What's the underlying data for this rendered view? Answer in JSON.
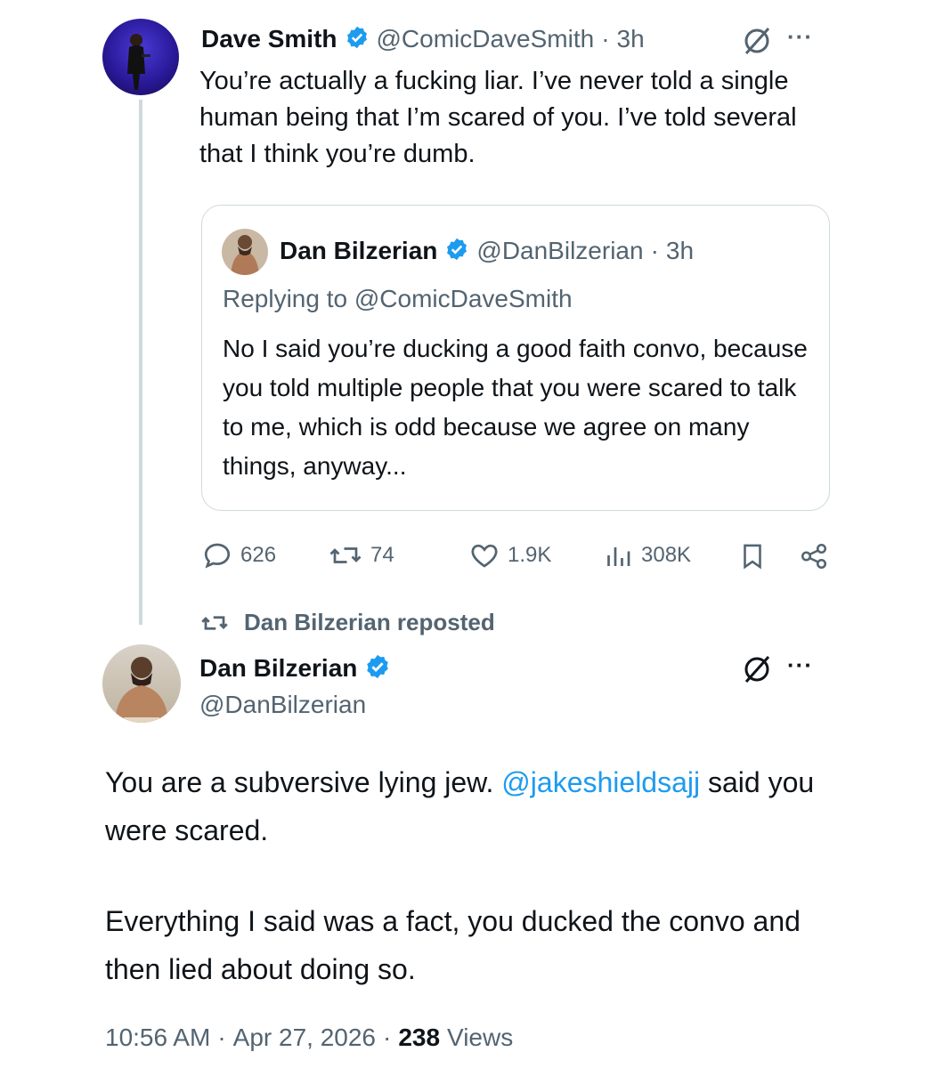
{
  "tweet": {
    "author_name": "Dave Smith",
    "author_handle": "@ComicDaveSmith",
    "separator": "·",
    "time": "3h",
    "text": "You’re actually a fucking liar. I’ve never told a single human being that I’m scared of you. I’ve told several that I think you’re dumb.",
    "more_label": "···"
  },
  "quoted": {
    "author_name": "Dan Bilzerian",
    "author_handle": "@DanBilzerian",
    "separator": "·",
    "time": "3h",
    "replying_to": "Replying to @ComicDaveSmith",
    "text": "No I said you’re ducking a good faith convo, because you told multiple people that you were scared to talk to me, which is odd because we agree on many things, anyway..."
  },
  "actions": {
    "replies": "626",
    "reposts": "74",
    "likes": "1.9K",
    "views": "308K"
  },
  "repost_notice": "Dan Bilzerian reposted",
  "reply_tweet": {
    "author_name": "Dan Bilzerian",
    "author_handle": "@DanBilzerian",
    "more_label": "···",
    "text_part1": "You are a subversive lying jew.",
    "mention": "@jakeshieldsajj",
    "text_part2": "said you were scared.",
    "text_para2": "Everything I said was a fact, you ducked the convo and then lied about doing so.",
    "time": "10:56 AM",
    "separator": "·",
    "date": "Apr 27, 2026",
    "views_count": "238",
    "views_label": "Views"
  },
  "colors": {
    "verified": "#1d9bf0",
    "link": "#1d9bf0",
    "muted": "#536471",
    "border": "#cfd9de"
  }
}
